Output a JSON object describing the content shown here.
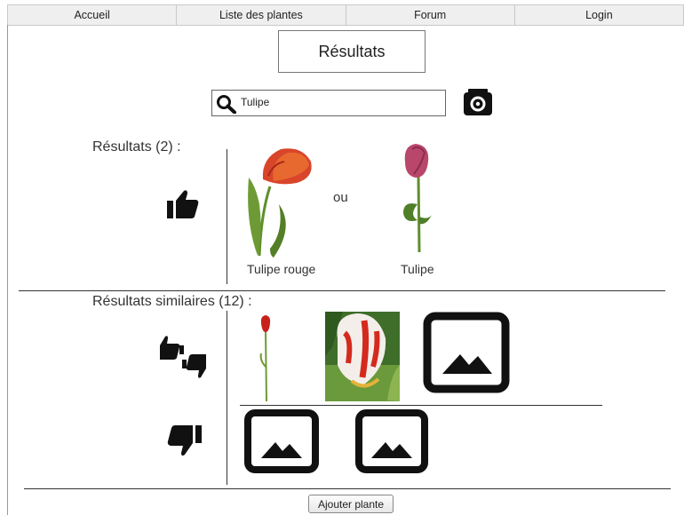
{
  "nav": {
    "items": [
      "Accueil",
      "Liste des plantes",
      "Forum",
      "Login"
    ]
  },
  "header": {
    "title": "Résultats"
  },
  "search": {
    "value": "Tulipe"
  },
  "results": {
    "label": "Résultats (2) :",
    "or_text": "ou",
    "items": [
      {
        "caption": "Tulipe rouge"
      },
      {
        "caption": "Tulipe"
      }
    ]
  },
  "similar": {
    "label": "Résultats similaires (12) :"
  },
  "footer": {
    "add_button": "Ajouter plante"
  },
  "icons": {
    "search": "search-icon",
    "camera": "camera-icon",
    "thumbs_up": "thumbs-up-icon",
    "thumbs_mixed": "thumbs-up-down-icon",
    "thumbs_down": "thumbs-down-icon",
    "image_placeholder": "image-placeholder-icon"
  },
  "colors": {
    "nav_background": "#efefef",
    "tulip_red": "#d9452a",
    "tulip_pink": "#b8476b",
    "leaf_green": "#5f8f2c"
  }
}
